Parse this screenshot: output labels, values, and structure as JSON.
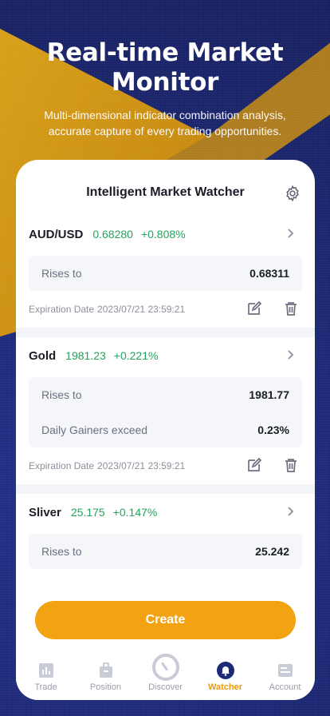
{
  "hero": {
    "title": "Real-time Market Monitor",
    "subtitle": "Multi-dimensional indicator combination analysis, accurate capture of every trading opportunities."
  },
  "watcher": {
    "title": "Intelligent Market Watcher",
    "settings_icon": "gear-icon",
    "alerts": [
      {
        "symbol": "AUD/USD",
        "price": "0.68280",
        "change": "+0.808%",
        "conditions": [
          {
            "label": "Rises to",
            "value": "0.68311"
          }
        ],
        "expiration_label": "Expiration Date",
        "expiration_date": "2023/07/21 23:59:21"
      },
      {
        "symbol": "Gold",
        "price": "1981.23",
        "change": "+0.221%",
        "conditions": [
          {
            "label": "Rises to",
            "value": "1981.77"
          },
          {
            "label": "Daily Gainers exceed",
            "value": "0.23%"
          }
        ],
        "expiration_label": "Expiration Date",
        "expiration_date": "2023/07/21 23:59:21"
      },
      {
        "symbol": "Sliver",
        "price": "25.175",
        "change": "+0.147%",
        "conditions": [
          {
            "label": "Rises to",
            "value": "25.242"
          }
        ]
      }
    ],
    "create_label": "Create"
  },
  "tabbar": {
    "items": [
      {
        "label": "Trade",
        "icon": "chart-bar-icon"
      },
      {
        "label": "Position",
        "icon": "briefcase-icon"
      },
      {
        "label": "Discover",
        "icon": "compass-icon"
      },
      {
        "label": "Watcher",
        "icon": "bell-icon"
      },
      {
        "label": "Account",
        "icon": "account-card-icon"
      }
    ],
    "active": "Watcher"
  },
  "colors": {
    "accent": "#f3a212",
    "positive": "#24a35e",
    "background_blue": "#1c2a78",
    "background_gold": "#d9a118"
  }
}
